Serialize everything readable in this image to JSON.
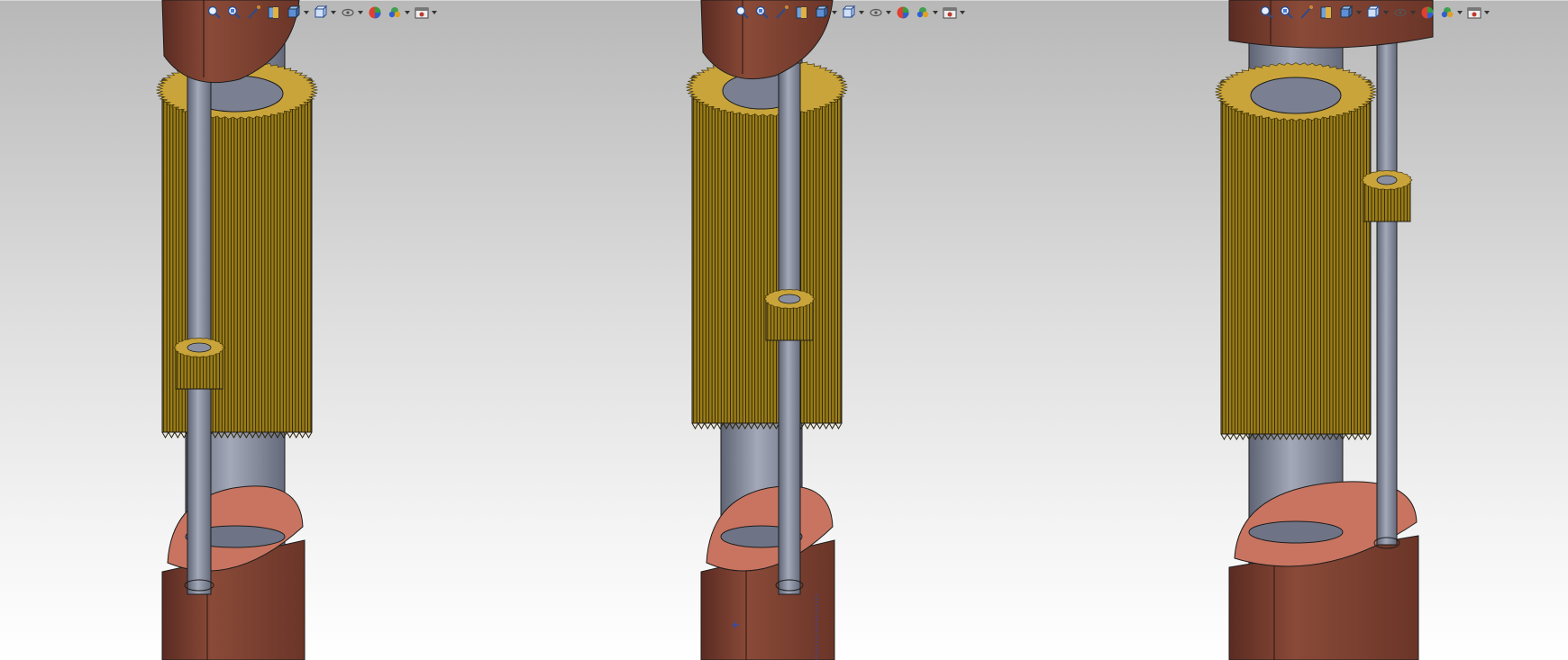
{
  "viewports": [
    {
      "id": "view-left",
      "gear_position": "lower",
      "cursor": false
    },
    {
      "id": "view-middle",
      "gear_position": "middle",
      "cursor": true
    },
    {
      "id": "view-right",
      "gear_position": "upper-offset",
      "cursor": false
    }
  ],
  "toolbar": {
    "icons": [
      {
        "name": "zoom-to-fit-icon",
        "dropdown": false
      },
      {
        "name": "zoom-to-area-icon",
        "dropdown": false
      },
      {
        "name": "previous-view-icon",
        "dropdown": false
      },
      {
        "name": "section-view-icon",
        "dropdown": false
      },
      {
        "name": "view-orientation-icon",
        "dropdown": true
      },
      {
        "name": "display-style-icon",
        "dropdown": true
      },
      {
        "name": "hide-show-items-icon",
        "dropdown": true
      },
      {
        "name": "edit-appearance-icon",
        "dropdown": false
      },
      {
        "name": "apply-scene-icon",
        "dropdown": true
      },
      {
        "name": "view-settings-icon",
        "dropdown": true
      }
    ]
  },
  "colors": {
    "housing": "#7a3e2f",
    "housing_top": "#c87460",
    "gear": "#9a7d17",
    "gear_top": "#c9a43a",
    "shaft": "#7e8597"
  }
}
